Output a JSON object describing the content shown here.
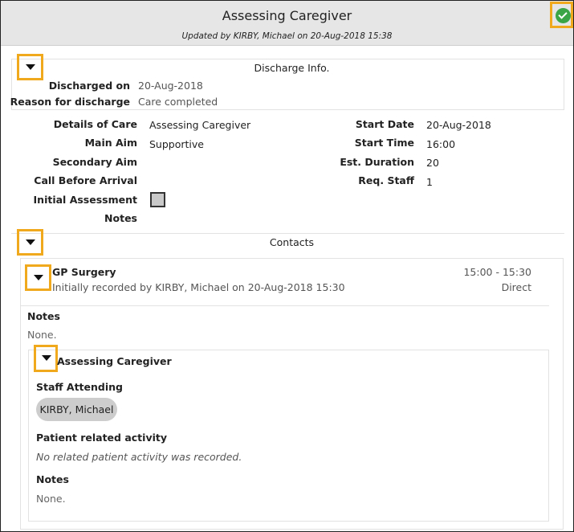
{
  "header": {
    "title": "Assessing Caregiver",
    "subtitle": "Updated by KIRBY, Michael on 20-Aug-2018 15:38",
    "status_icon": "check-circle-icon",
    "status_color": "#3aa546"
  },
  "discharge": {
    "title": "Discharge Info.",
    "discharged_on_label": "Discharged on",
    "discharged_on_value": "20-Aug-2018",
    "reason_label": "Reason for discharge",
    "reason_value": "Care completed"
  },
  "details": {
    "details_of_care_label": "Details of Care",
    "details_of_care_value": "Assessing Caregiver",
    "main_aim_label": "Main Aim",
    "main_aim_value": "Supportive",
    "secondary_aim_label": "Secondary Aim",
    "call_before_label": "Call Before Arrival",
    "initial_assessment_label": "Initial Assessment",
    "notes_label": "Notes",
    "start_date_label": "Start Date",
    "start_date_value": "20-Aug-2018",
    "start_time_label": "Start Time",
    "start_time_value": "16:00",
    "est_duration_label": "Est. Duration",
    "est_duration_value": "20",
    "req_staff_label": "Req. Staff",
    "req_staff_value": "1"
  },
  "contacts": {
    "title": "Contacts",
    "contact": {
      "name": "GP Surgery",
      "recorded": "Initially recorded by KIRBY, Michael on 20-Aug-2018 15:30",
      "time": "15:00 - 15:30",
      "method": "Direct",
      "notes_label": "Notes",
      "notes_value": "None.",
      "activity": {
        "title": "Assessing Caregiver",
        "staff_label": "Staff Attending",
        "staff_chip": "KIRBY, Michael",
        "patient_activity_label": "Patient related activity",
        "patient_activity_value": "No related patient activity was recorded.",
        "notes_label": "Notes",
        "notes_value": "None."
      }
    }
  },
  "accent_color": "#f0a81c"
}
